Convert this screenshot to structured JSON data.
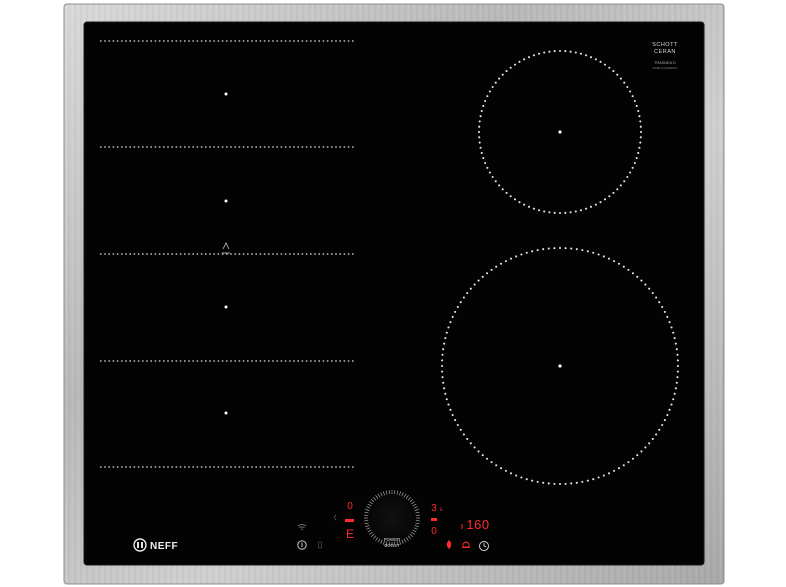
{
  "hob": {
    "glass_brand_line1": "SCHOTT",
    "glass_brand_line2": "CERAN",
    "glass_model": "TRASNEA D",
    "glass_small_text": "MADE IN GERMANY",
    "brand_logo": "NEFF",
    "power_boost_line1": "POWER",
    "power_boost_line2": "BOOST",
    "left_display_top": "0",
    "left_display_bottom": "E",
    "mid_display_top": "3",
    "mid_display_small": "s",
    "mid_display_bottom": "0",
    "timer_display": "160",
    "icons": [
      "wifi-icon",
      "power-icon",
      "lock-icon",
      "flame-icon",
      "clock-icon",
      "bell-icon"
    ]
  },
  "colors": {
    "glass": "#030303",
    "frame_light": "#e2e2e2",
    "frame_dark": "#9a9a9a",
    "zone_dots": "#e6e6e6",
    "display_red": "#ff2a2a"
  }
}
